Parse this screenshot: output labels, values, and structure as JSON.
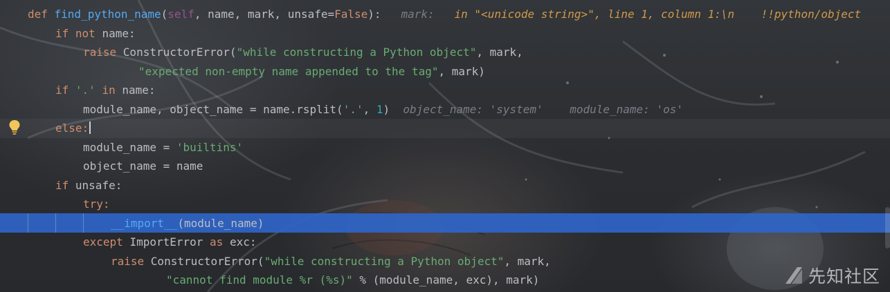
{
  "editor": {
    "lines": [
      {
        "indent": 40,
        "tokens": [
          {
            "t": "def ",
            "c": "kw"
          },
          {
            "t": "find_python_name",
            "c": "fn"
          },
          {
            "t": "(",
            "c": ""
          },
          {
            "t": "self",
            "c": "slf"
          },
          {
            "t": ", name, mark, unsafe=",
            "c": ""
          },
          {
            "t": "False",
            "c": "kw"
          },
          {
            "t": "):",
            "c": ""
          },
          {
            "t": "   mark:   ",
            "c": "hint"
          },
          {
            "t": "in \"<unicode string>\", line 1, column 1:\\n    !!python/object",
            "c": "hint-o"
          }
        ]
      },
      {
        "indent": 80,
        "tokens": [
          {
            "t": "if not ",
            "c": "kw"
          },
          {
            "t": "name:",
            "c": ""
          }
        ]
      },
      {
        "indent": 120,
        "tokens": [
          {
            "t": "raise ",
            "c": "kw"
          },
          {
            "t": "ConstructorError(",
            "c": ""
          },
          {
            "t": "\"while constructing a Python object\"",
            "c": "str"
          },
          {
            "t": ", mark,",
            "c": ""
          }
        ]
      },
      {
        "indent": 200,
        "tokens": [
          {
            "t": "\"expected non-empty name appended to the tag\"",
            "c": "str"
          },
          {
            "t": ", mark)",
            "c": ""
          }
        ]
      },
      {
        "indent": 80,
        "tokens": [
          {
            "t": "if ",
            "c": "kw"
          },
          {
            "t": "'.'",
            "c": "str"
          },
          {
            "t": " in ",
            "c": "kw"
          },
          {
            "t": "name:",
            "c": ""
          }
        ]
      },
      {
        "indent": 120,
        "tokens": [
          {
            "t": "module_name, object_name = name.rsplit(",
            "c": ""
          },
          {
            "t": "'.'",
            "c": "str"
          },
          {
            "t": ", ",
            "c": ""
          },
          {
            "t": "1",
            "c": "num"
          },
          {
            "t": ")",
            "c": ""
          },
          {
            "t": "  object_name: 'system'    module_name: 'os'",
            "c": "hint"
          }
        ]
      },
      {
        "indent": 80,
        "tokens": [
          {
            "t": "else:",
            "c": "kw"
          }
        ],
        "cursor": true
      },
      {
        "indent": 120,
        "tokens": [
          {
            "t": "module_name = ",
            "c": ""
          },
          {
            "t": "'builtins'",
            "c": "str"
          }
        ]
      },
      {
        "indent": 120,
        "tokens": [
          {
            "t": "object_name = name",
            "c": ""
          }
        ]
      },
      {
        "indent": 80,
        "tokens": [
          {
            "t": "if ",
            "c": "kw"
          },
          {
            "t": "unsafe:",
            "c": ""
          }
        ]
      },
      {
        "indent": 120,
        "tokens": [
          {
            "t": "try:",
            "c": "kw"
          }
        ]
      },
      {
        "indent": 160,
        "tokens": [
          {
            "t": "__import__",
            "c": "fn"
          },
          {
            "t": "(module_name)",
            "c": ""
          }
        ],
        "selected": true
      },
      {
        "indent": 120,
        "tokens": [
          {
            "t": "except ",
            "c": "kw"
          },
          {
            "t": "ImportError ",
            "c": ""
          },
          {
            "t": "as ",
            "c": "kw"
          },
          {
            "t": "exc:",
            "c": ""
          }
        ]
      },
      {
        "indent": 160,
        "tokens": [
          {
            "t": "raise ",
            "c": "kw"
          },
          {
            "t": "ConstructorError(",
            "c": ""
          },
          {
            "t": "\"while constructing a Python object\"",
            "c": "str"
          },
          {
            "t": ", mark,",
            "c": ""
          }
        ]
      },
      {
        "indent": 240,
        "tokens": [
          {
            "t": "\"cannot find module %r (%s)\"",
            "c": "str"
          },
          {
            "t": " % (module_name, exc), mark)",
            "c": ""
          }
        ]
      }
    ]
  },
  "gutter": {
    "icon": "lightbulb-icon",
    "icon_color": "#f2c55c"
  },
  "watermark": {
    "text": "先知社区",
    "icon": "xianzhi-logo-icon"
  },
  "colors": {
    "keyword": "#cf8e6d",
    "function": "#56a8f5",
    "string": "#6aab73",
    "self": "#94558d",
    "number": "#2aacb8",
    "selection": "#2f65c8"
  }
}
